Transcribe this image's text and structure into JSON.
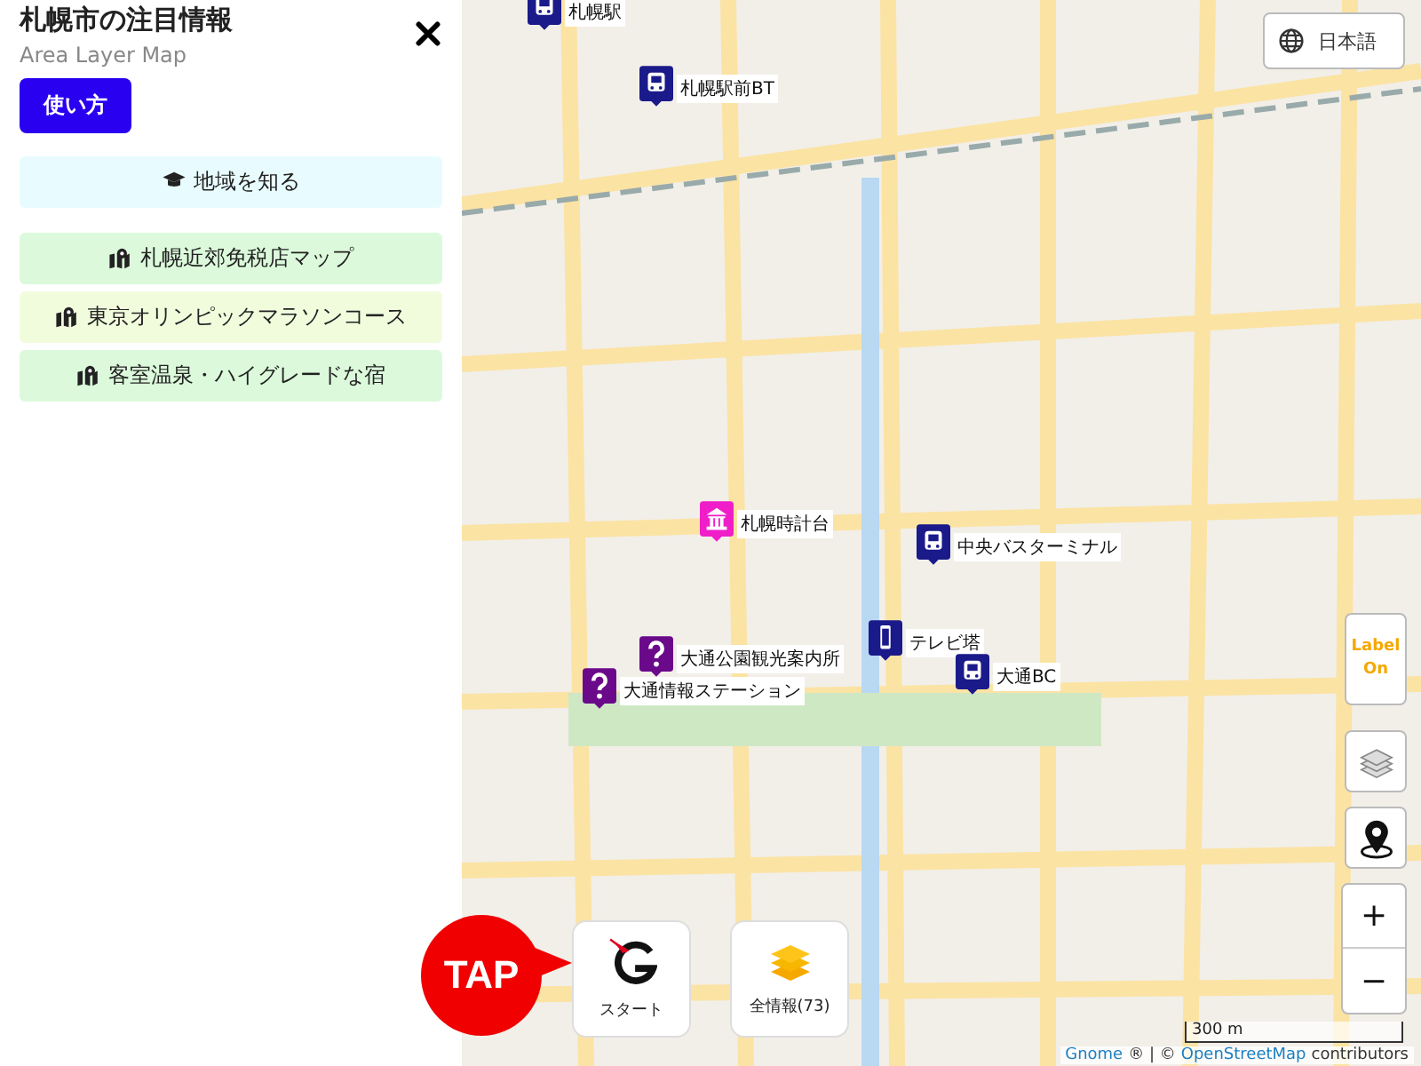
{
  "sidebar": {
    "title": "札幌市の注目情報",
    "subtitle": "Area Layer Map",
    "help_button": "使い方",
    "sections": [
      {
        "label": "地域を知る",
        "kind": "learn",
        "color": "#e8fcff"
      }
    ],
    "layers": [
      {
        "label": "札幌近郊免税店マップ",
        "kind": "map",
        "color": "#dcfadb"
      },
      {
        "label": "東京オリンピックマラソンコース",
        "kind": "map",
        "color": "#f1fcdd"
      },
      {
        "label": "客室温泉・ハイグレードな宿",
        "kind": "map",
        "color": "#dcfadb"
      }
    ]
  },
  "map": {
    "language_button": "日本語",
    "label_toggle": "Label On",
    "markers": [
      {
        "kind": "bus",
        "label": "札幌駅"
      },
      {
        "kind": "bus",
        "label": "札幌駅前BT"
      },
      {
        "kind": "museum",
        "label": "札幌時計台"
      },
      {
        "kind": "bus",
        "label": "中央バスターミナル"
      },
      {
        "kind": "tower",
        "label": "テレビ塔"
      },
      {
        "kind": "bus",
        "label": "大通BC"
      },
      {
        "kind": "info",
        "label": "大通公園観光案内所"
      },
      {
        "kind": "info",
        "label": "大通情報ステーション"
      }
    ],
    "tap_badge": "TAP",
    "start_button": "スタート",
    "all_button": "全情報(73)",
    "zoom_in": "+",
    "zoom_out": "−",
    "scale": "300 m",
    "attribution": {
      "link_1": "Gnome",
      "mark": "®",
      "separator": "|",
      "copyright": "©",
      "link_2": "OpenStreetMap",
      "suffix": "contributors"
    }
  }
}
